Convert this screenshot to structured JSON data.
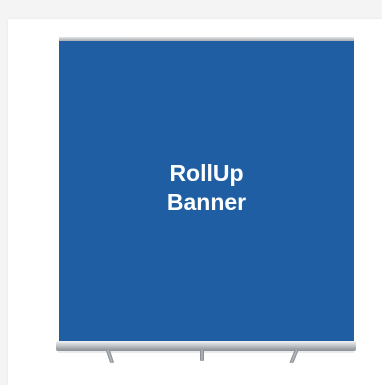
{
  "banner": {
    "line1": "RollUp",
    "line2": "Banner",
    "color": "#1f5ea3"
  }
}
